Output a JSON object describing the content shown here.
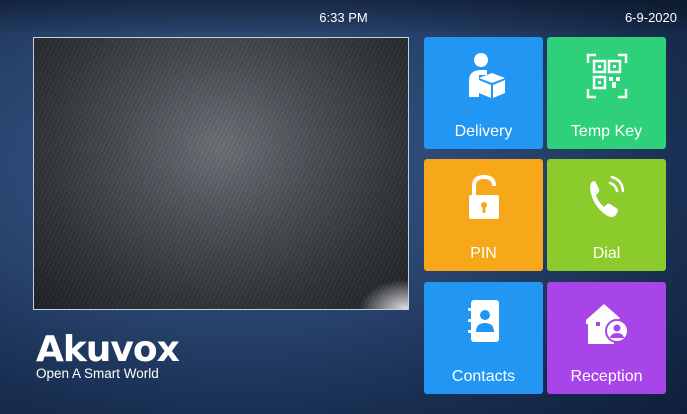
{
  "status": {
    "time": "6:33 PM",
    "date": "6-9-2020"
  },
  "brand": {
    "name": "Akuvox",
    "slogan": "Open A Smart World"
  },
  "tiles": [
    {
      "label": "Delivery",
      "icon": "delivery-icon",
      "color": "#2196f3"
    },
    {
      "label": "Temp Key",
      "icon": "qr-code-icon",
      "color": "#2ed07a"
    },
    {
      "label": "PIN",
      "icon": "unlock-icon",
      "color": "#f7a81a"
    },
    {
      "label": "Dial",
      "icon": "phone-call-icon",
      "color": "#8ccb2c"
    },
    {
      "label": "Contacts",
      "icon": "contacts-book-icon",
      "color": "#2196f3"
    },
    {
      "label": "Reception",
      "icon": "house-person-icon",
      "color": "#a845e8"
    }
  ]
}
